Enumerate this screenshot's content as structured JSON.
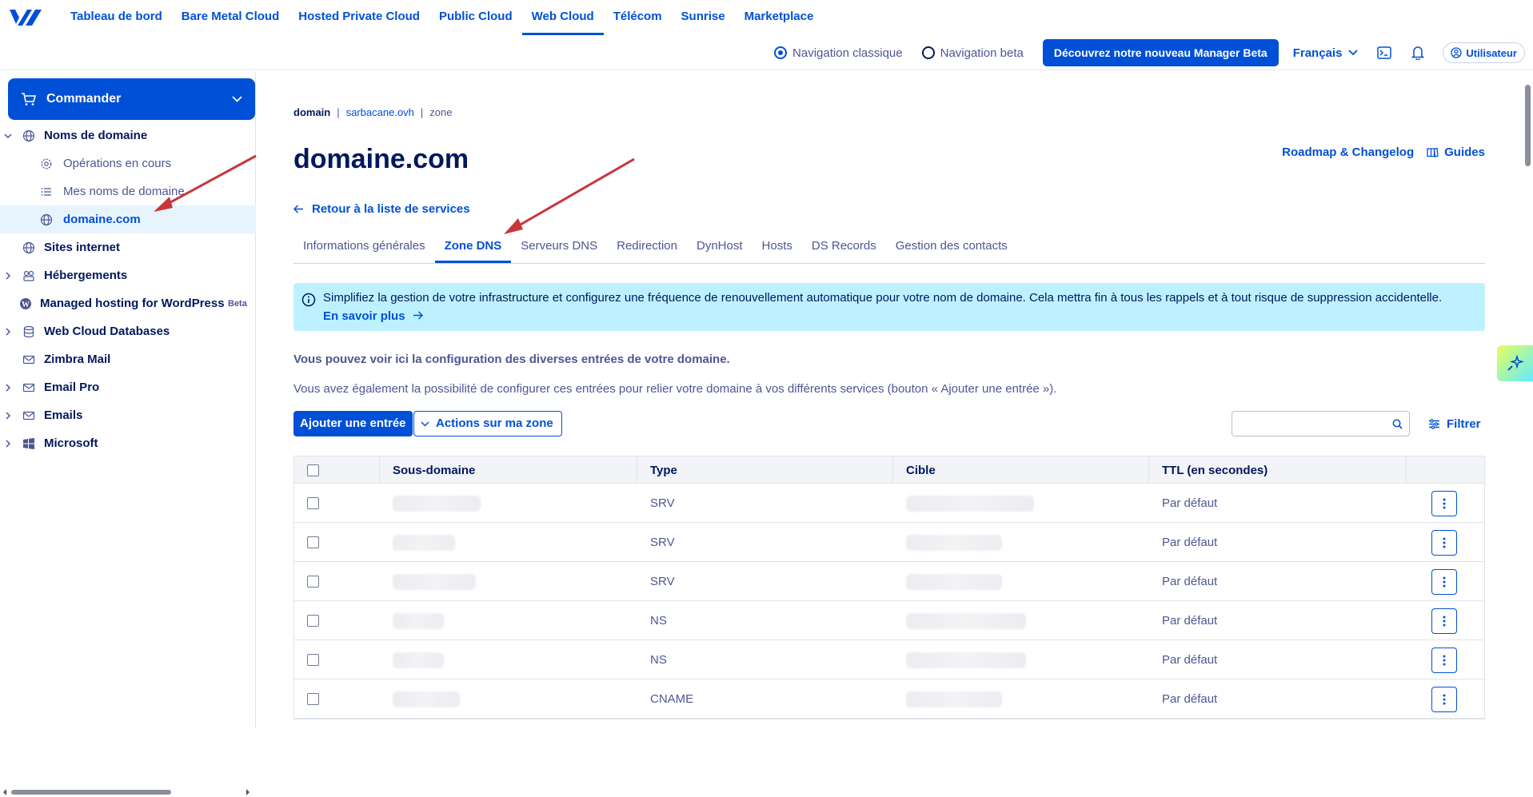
{
  "topbar": {
    "universes": [
      "Tableau de bord",
      "Bare Metal Cloud",
      "Hosted Private Cloud",
      "Public Cloud",
      "Web Cloud",
      "Télécom",
      "Sunrise",
      "Marketplace"
    ],
    "active_universe": "Web Cloud",
    "nav_classic": "Navigation classique",
    "nav_beta": "Navigation beta",
    "beta_button": "Découvrez notre nouveau Manager Beta",
    "language": "Français",
    "user": "Utilisateur",
    "accent_color": "#0050d7"
  },
  "sidebar": {
    "order_label": "Commander",
    "items": [
      {
        "label": "Noms de domaine",
        "icon": "globe-icon",
        "caret": "down"
      },
      {
        "label": "Opérations en cours",
        "icon": "gear-icon",
        "sub": true
      },
      {
        "label": "Mes noms de domaine",
        "icon": "list-icon",
        "sub": true
      },
      {
        "label": "domaine.com",
        "icon": "globe-icon",
        "sub": true,
        "active": true
      },
      {
        "label": "Sites internet",
        "icon": "globe-icon"
      },
      {
        "label": "Hébergements",
        "icon": "hosting-icon",
        "caret": "right"
      },
      {
        "label": "Managed hosting for WordPress",
        "icon": "wordpress-icon",
        "badge": "Beta"
      },
      {
        "label": "Web Cloud Databases",
        "icon": "database-icon",
        "caret": "right"
      },
      {
        "label": "Zimbra Mail",
        "icon": "mail-icon"
      },
      {
        "label": "Email Pro",
        "icon": "mail-icon",
        "caret": "right"
      },
      {
        "label": "Emails",
        "icon": "mail-icon",
        "caret": "right"
      },
      {
        "label": "Microsoft",
        "icon": "windows-icon",
        "caret": "right"
      }
    ]
  },
  "main": {
    "breadcrumb": [
      "domain",
      "sarbacane.ovh",
      "zone"
    ],
    "title": "domaine.com",
    "roadmap_link": "Roadmap & Changelog",
    "guides_link": "Guides",
    "back_link": "Retour à la liste de services",
    "tabs": [
      "Informations générales",
      "Zone DNS",
      "Serveurs DNS",
      "Redirection",
      "DynHost",
      "Hosts",
      "DS Records",
      "Gestion des contacts"
    ],
    "active_tab": "Zone DNS",
    "alert_text": "Simplifiez la gestion de votre infrastructure et configurez une fréquence de renouvellement automatique pour votre nom de domaine. Cela mettra fin à tous les rappels et à tout risque de suppression accidentelle.",
    "alert_link": "En savoir plus",
    "intro1": "Vous pouvez voir ici la configuration des diverses entrées de votre domaine.",
    "intro2": "Vous avez également la possibilité de configurer ces entrées pour relier votre domaine à vos différents services (bouton « Ajouter une entrée »).",
    "add_button": "Ajouter une entrée",
    "actions_button": "Actions sur ma zone",
    "filter_button": "Filtrer",
    "table": {
      "headers": [
        "Sous-domaine",
        "Type",
        "Cible",
        "TTL (en secondes)"
      ],
      "rows": [
        {
          "type": "SRV",
          "ttl": "Par défaut"
        },
        {
          "type": "SRV",
          "ttl": "Par défaut"
        },
        {
          "type": "SRV",
          "ttl": "Par défaut"
        },
        {
          "type": "NS",
          "ttl": "Par défaut"
        },
        {
          "type": "NS",
          "ttl": "Par défaut"
        },
        {
          "type": "CNAME",
          "ttl": "Par défaut"
        }
      ]
    }
  }
}
